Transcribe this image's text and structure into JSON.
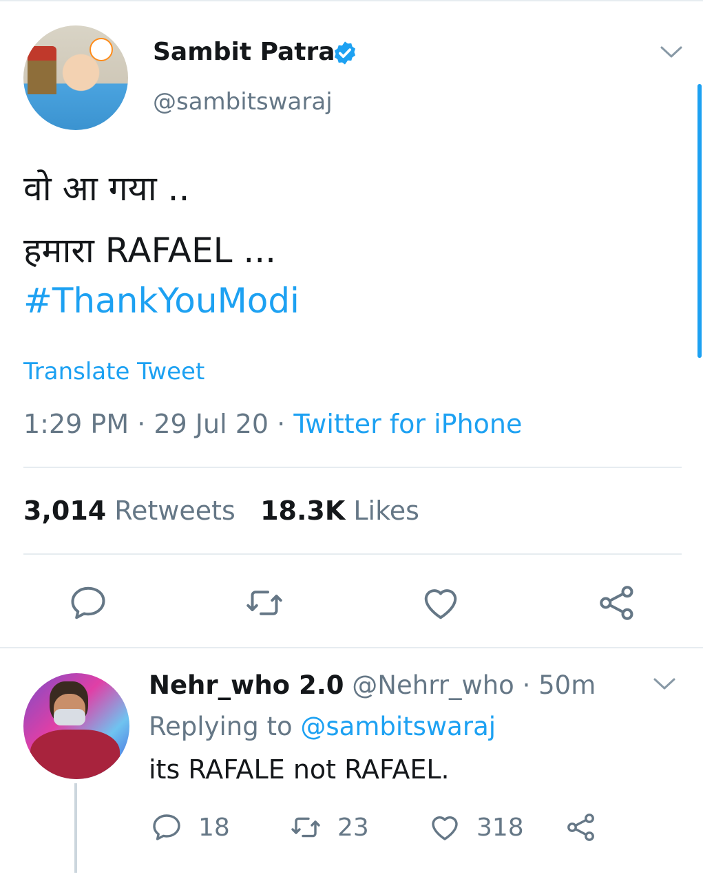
{
  "tweet": {
    "author_name": "Sambit Patra",
    "author_handle": "@sambitswaraj",
    "lines": [
      "वो आ गया ..",
      "हमारा RAFAEL ..."
    ],
    "hashtag": "#ThankYouModi",
    "translate_label": "Translate Tweet",
    "time": "1:29 PM",
    "date": "29 Jul 20",
    "source": "Twitter for iPhone",
    "retweets_count": "3,014",
    "retweets_label": "Retweets",
    "likes_count": "18.3K",
    "likes_label": "Likes"
  },
  "reply": {
    "author_name": "Nehr_who 2.0",
    "author_handle": "@Nehrr_who",
    "age": "50m",
    "replying_label": "Replying to",
    "replying_to": "@sambitswaraj",
    "text": "its RAFALE not RAFAEL.",
    "reply_count": "18",
    "retweet_count": "23",
    "like_count": "318"
  },
  "colors": {
    "accent": "#1da1f2",
    "secondary_text": "#657786",
    "primary_text": "#14171a",
    "divider": "#e6ecf0"
  },
  "icons": [
    "verified-badge-icon",
    "chevron-down-icon",
    "reply-icon",
    "retweet-icon",
    "like-icon",
    "share-icon"
  ]
}
